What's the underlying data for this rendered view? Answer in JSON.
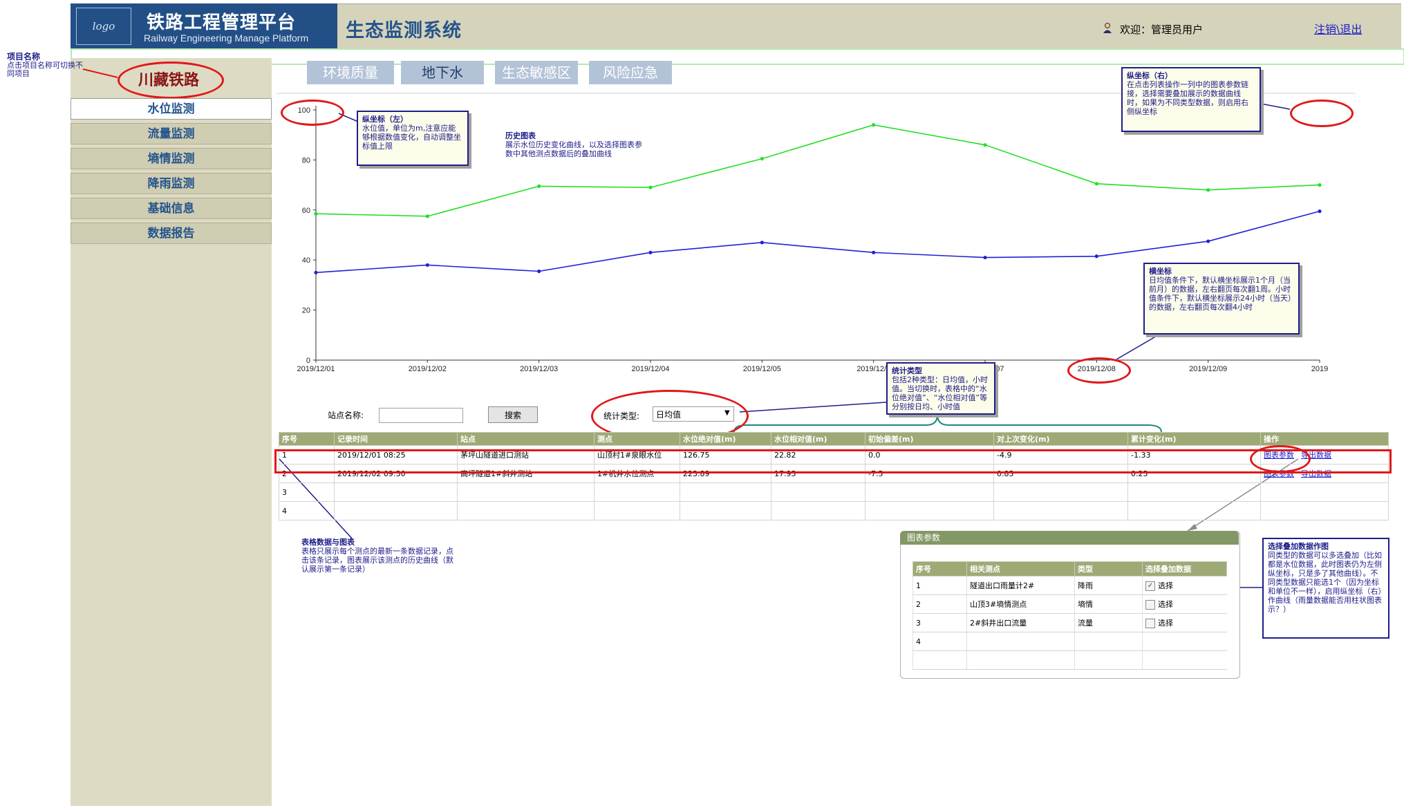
{
  "header": {
    "logo_text": "logo",
    "platform_title": "铁路工程管理平台",
    "platform_subtitle": "Railway Engineering Manage Platform",
    "system_title": "生态监测系统",
    "welcome": "欢迎：管理员用户",
    "logout": "注销\\退出"
  },
  "project": {
    "note_title": "项目名称",
    "note_text": "点击项目名称可切换不同项目",
    "name": "川藏铁路"
  },
  "sidebar": {
    "items": [
      {
        "label": "水位监测",
        "active": true
      },
      {
        "label": "流量监测",
        "active": false
      },
      {
        "label": "墒情监测",
        "active": false
      },
      {
        "label": "降雨监测",
        "active": false
      },
      {
        "label": "基础信息",
        "active": false
      },
      {
        "label": "数据报告",
        "active": false
      }
    ]
  },
  "tabs": [
    {
      "label": "环境质量"
    },
    {
      "label": "地下水"
    },
    {
      "label": "生态敏感区"
    },
    {
      "label": "风险应急"
    }
  ],
  "chart_data": {
    "type": "line",
    "x": [
      "2019/12/01",
      "2019/12/02",
      "2019/12/03",
      "2019/12/04",
      "2019/12/05",
      "2019/12/06",
      "2019/12/07",
      "2019/12/08",
      "2019/12/09",
      "2019/12/10"
    ],
    "x_tick_labels": [
      "2019/12/01",
      "2019/12/02",
      "2019/12/03",
      "2019/12/04",
      "2019/12/05",
      "2019/12/0",
      "2019/12/07",
      "2019/12/08",
      "2019/12/09",
      "2019"
    ],
    "series": [
      {
        "color": "#22e022",
        "values": [
          58.5,
          57.5,
          69.5,
          69,
          80.5,
          94,
          86,
          70.5,
          68,
          70
        ]
      },
      {
        "color": "#2020d8",
        "values": [
          35,
          38,
          35.5,
          43,
          47,
          43,
          41,
          41.5,
          47.5,
          59.5
        ]
      }
    ],
    "y_ticks": [
      0,
      20,
      40,
      60,
      80,
      100
    ],
    "ylim": [
      0,
      100
    ],
    "grid": false
  },
  "notes": {
    "y_left_title": "纵坐标（左）",
    "y_left_text": "水位值，单位为m,注意应能够根据数值变化，自动调整坐标值上限",
    "history_title": "历史图表",
    "history_text": "展示水位历史变化曲线，以及选择图表参数中其他测点数据后的叠加曲线",
    "y_right_title": "纵坐标（右）",
    "y_right_text": "在点击列表操作一列中的图表参数链接，选择需要叠加展示的数据曲线时，如果为不同类型数据，则启用右侧纵坐标",
    "x_axis_title": "横坐标",
    "x_axis_text": "日均值条件下，默认横坐标展示1个月（当前月）的数据，左右翻页每次翻1周。小时值条件下，默认横坐标展示24小时（当天）的数据，左右翻页每次翻4小时",
    "stat_title": "统计类型",
    "stat_text": "包括2种类型：日均值，小时值。当切换时，表格中的“水位绝对值”、“水位相对值”等分别按日均、小时值",
    "table_title": "表格数据与图表",
    "table_text": "表格只展示每个测点的最新一条数据记录，点击该条记录，图表展示该测点的历史曲线（默认展示第一条记录）",
    "overlay_title": "选择叠加数据作图",
    "overlay_text": "同类型的数据可以多选叠加（比如都是水位数据，此时图表仍为左侧纵坐标，只是多了其他曲线）。不同类型数据只能选1个（因为坐标和单位不一样），启用纵坐标（右）作曲线（雨量数据能否用柱状图表示？）"
  },
  "search": {
    "station_label": "站点名称:",
    "station_value": "",
    "search_button": "搜索",
    "stat_label": "统计类型:",
    "stat_value": "日均值"
  },
  "table": {
    "headers": [
      "序号",
      "记录时间",
      "站点",
      "测点",
      "水位绝对值(m)",
      "水位相对值(m)",
      "初始偏差(m)",
      "对上次变化(m)",
      "累计变化(m)",
      "操作"
    ],
    "rows": [
      {
        "cells": [
          "1",
          "2019/12/01 08:25",
          "茅坪山隧道进口测站",
          "山顶村1#泉眼水位",
          "126.75",
          "22.82",
          "0.0",
          "-4.9",
          "-1.33"
        ],
        "link1": "图表参数",
        "link2": "导出数据"
      },
      {
        "cells": [
          "2",
          "2019/12/02 09:30",
          "高坪隧道1#斜井测站",
          "1#机井水位测点",
          "223.89",
          "17.95",
          "-7.5",
          "0.85",
          "0.25"
        ],
        "link1": "图表参数",
        "link2": "导出数据"
      },
      {
        "cells": [
          "3",
          "",
          "",
          "",
          "",
          "",
          "",
          "",
          ""
        ],
        "link1": "",
        "link2": ""
      },
      {
        "cells": [
          "4",
          "",
          "",
          "",
          "",
          "",
          "",
          "",
          ""
        ],
        "link1": "",
        "link2": ""
      }
    ]
  },
  "panel": {
    "title": "图表参数",
    "headers": [
      "序号",
      "相关测点",
      "类型",
      "选择叠加数据"
    ],
    "rows": [
      {
        "no": "1",
        "point": "隧道出口雨量计2#",
        "type": "降雨",
        "check": "选择",
        "checked": true
      },
      {
        "no": "2",
        "point": "山顶3#墒情测点",
        "type": "墒情",
        "check": "选择",
        "checked": false
      },
      {
        "no": "3",
        "point": "2#斜井出口流量",
        "type": "流量",
        "check": "选择",
        "checked": false
      },
      {
        "no": "4",
        "point": "",
        "type": "",
        "check": "",
        "checked": false
      },
      {
        "no": "",
        "point": "",
        "type": "",
        "check": "",
        "checked": false
      }
    ]
  },
  "colors": {
    "brand": "#224f86",
    "header_bg": "#d6d3bb",
    "annotation_red": "#e01818",
    "annotation_blue": "#1d1d8a",
    "table_header": "#9eaa76"
  }
}
